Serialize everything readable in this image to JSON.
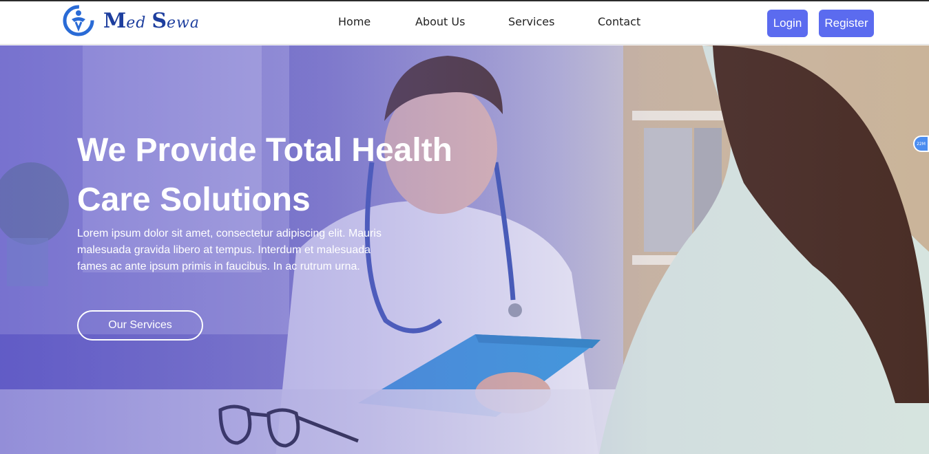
{
  "brand": {
    "name_m": "M",
    "name_ed": "ed",
    "name_s": "S",
    "name_ewa": "ewa"
  },
  "nav": {
    "items": [
      {
        "label": "Home"
      },
      {
        "label": "About Us"
      },
      {
        "label": "Services"
      },
      {
        "label": "Contact"
      }
    ],
    "login": "Login",
    "register": "Register"
  },
  "hero": {
    "title": "We Provide Total Health Care Solutions",
    "text": "Lorem ipsum dolor sit amet, consectetur adipiscing elit. Mauris malesuada gravida libero at tempus. Interdum et malesuada fames ac ante ipsum primis in faucibus. In ac rutrum urna.",
    "button": "Our Services"
  },
  "badge": {
    "label": "22M"
  },
  "colors": {
    "accent": "#5b6bef",
    "brand": "#1d3e9e",
    "overlay": "#6f6cc4"
  }
}
